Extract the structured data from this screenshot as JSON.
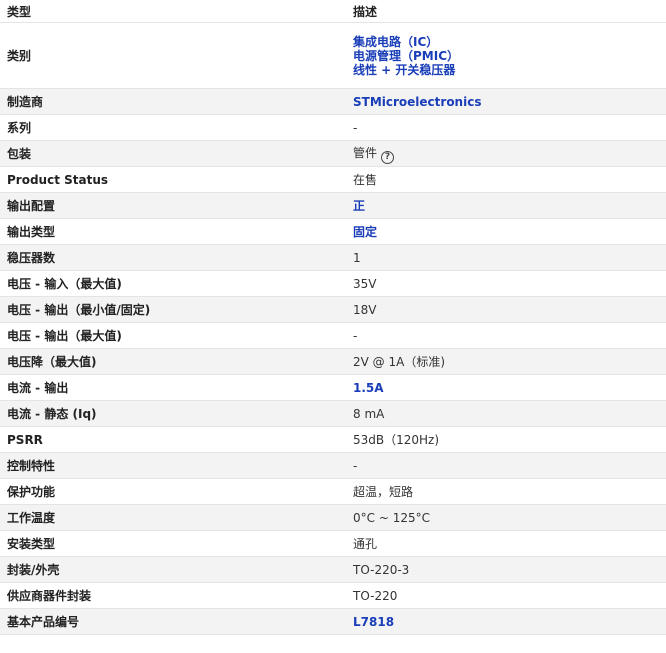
{
  "header": {
    "type_label": "类型",
    "desc_label": "描述"
  },
  "category": {
    "label": "类别",
    "links": [
      "集成电路（IC）",
      "电源管理（PMIC）",
      "线性 + 开关稳压器"
    ]
  },
  "rows": [
    {
      "key": "制造商",
      "value": "STMicroelectronics",
      "style": "link"
    },
    {
      "key": "系列",
      "value": "-",
      "style": "normal"
    },
    {
      "key": "包装",
      "value": "管件",
      "style": "normal",
      "help": "?"
    },
    {
      "key": "Product Status",
      "value": "在售",
      "style": "normal"
    },
    {
      "key": "输出配置",
      "value": "正",
      "style": "blue"
    },
    {
      "key": "输出类型",
      "value": "固定",
      "style": "blue"
    },
    {
      "key": "稳压器数",
      "value": "1",
      "style": "normal"
    },
    {
      "key": "电压 - 输入（最大值)",
      "value": "35V",
      "style": "normal"
    },
    {
      "key": "电压 - 输出（最小值/固定)",
      "value": "18V",
      "style": "normal"
    },
    {
      "key": "电压 - 输出（最大值)",
      "value": "-",
      "style": "normal"
    },
    {
      "key": "电压降（最大值)",
      "value": "2V @ 1A（标准)",
      "style": "normal"
    },
    {
      "key": "电流 - 输出",
      "value": "1.5A",
      "style": "blue"
    },
    {
      "key": "电流 - 静态 (Iq)",
      "value": "8 mA",
      "style": "normal"
    },
    {
      "key": "PSRR",
      "value": "53dB（120Hz)",
      "style": "normal"
    },
    {
      "key": "控制特性",
      "value": "-",
      "style": "normal"
    },
    {
      "key": "保护功能",
      "value": "超温，短路",
      "style": "normal"
    },
    {
      "key": "工作温度",
      "value": "0°C ~ 125°C",
      "style": "normal"
    },
    {
      "key": "安装类型",
      "value": "通孔",
      "style": "normal"
    },
    {
      "key": "封装/外壳",
      "value": "TO-220-3",
      "style": "normal"
    },
    {
      "key": "供应商器件封装",
      "value": "TO-220",
      "style": "normal"
    },
    {
      "key": "基本产品编号",
      "value": "L7818",
      "style": "link"
    }
  ]
}
